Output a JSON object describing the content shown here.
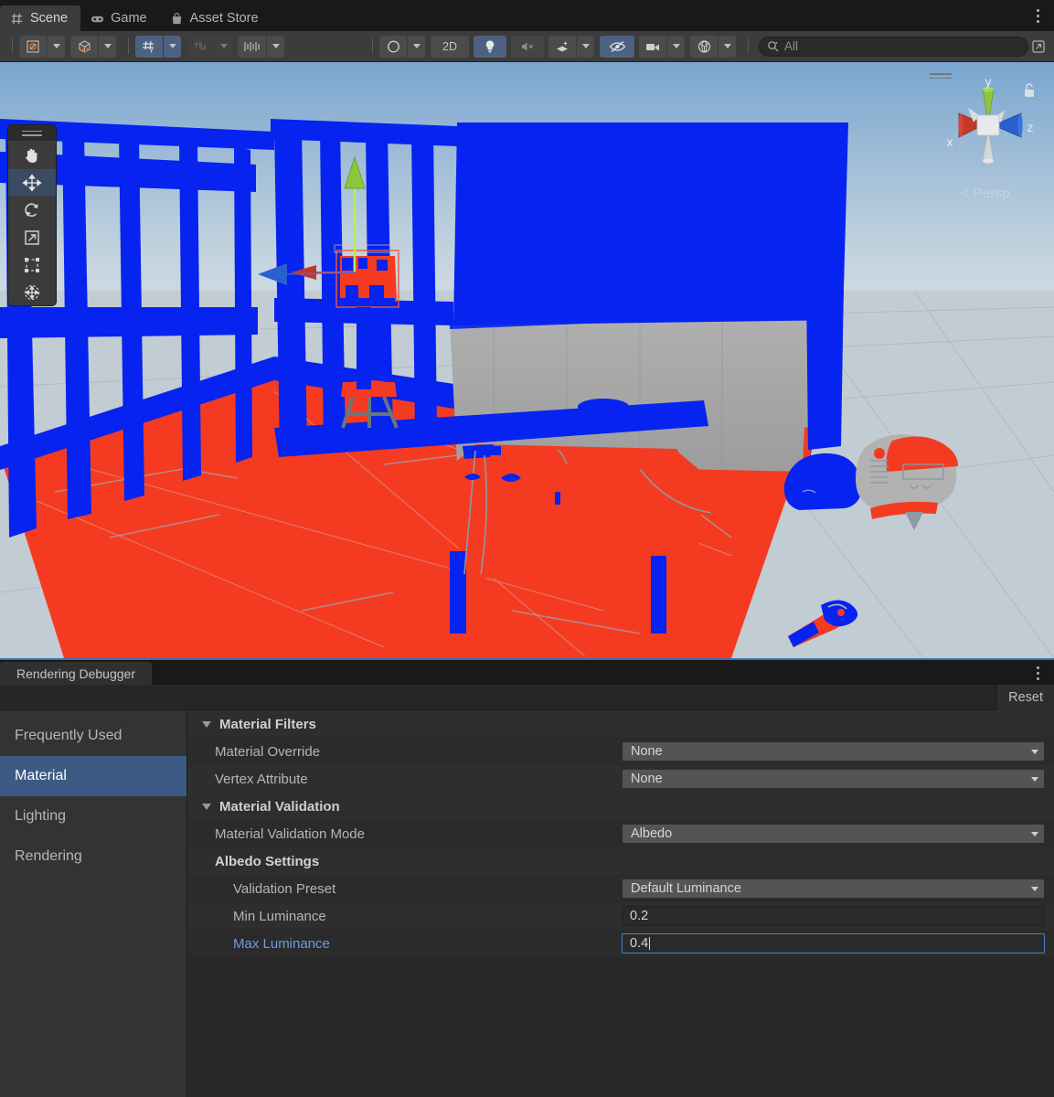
{
  "window": {
    "tabs": [
      {
        "label": "Scene",
        "icon": "grid-icon",
        "active": true
      },
      {
        "label": "Game",
        "icon": "gamepad-icon",
        "active": false
      },
      {
        "label": "Asset Store",
        "icon": "shopping-bag-icon",
        "active": false
      }
    ],
    "menu_icon": "kebab-menu-icon"
  },
  "scene_toolbar": {
    "pivot_mode": {
      "icon": "pivot-center-icon",
      "label": ""
    },
    "pivot_rotation": {
      "icon": "pivot-global-icon",
      "label": ""
    },
    "grid_snap": {
      "icon": "grid-snap-icon",
      "active": true
    },
    "magnet_snap": {
      "icon": "magnet-snap-icon",
      "active": false
    },
    "increment_snap": {
      "icon": "increment-snap-icon",
      "active": false
    },
    "shading_mode": {
      "icon": "shaded-sphere-icon"
    },
    "view_2d": {
      "label": "2D",
      "active": false
    },
    "scene_lighting": {
      "icon": "lightbulb-icon",
      "active": true
    },
    "audio": {
      "icon": "audio-mute-icon",
      "active": false
    },
    "effects": {
      "icon": "fx-sparkle-icon"
    },
    "hidden_objects": {
      "icon": "eye-slash-icon",
      "active": true
    },
    "camera": {
      "icon": "camera-icon"
    },
    "gizmos": {
      "icon": "gizmo-globe-icon"
    },
    "search": {
      "placeholder": "All",
      "value": "",
      "icon": "search-icon"
    },
    "expand": {
      "icon": "expand-panel-icon"
    }
  },
  "scene_view": {
    "tools": [
      {
        "name": "hand-tool",
        "icon": "hand-icon",
        "selected": false
      },
      {
        "name": "move-tool",
        "icon": "move-arrows-icon",
        "selected": true
      },
      {
        "name": "rotate-tool",
        "icon": "rotate-icon",
        "selected": false
      },
      {
        "name": "scale-tool",
        "icon": "scale-icon",
        "selected": false
      },
      {
        "name": "rect-tool",
        "icon": "rect-transform-icon",
        "selected": false
      },
      {
        "name": "transform-tool",
        "icon": "transform-icon",
        "selected": false
      }
    ],
    "orientation_gizmo": {
      "axis_x": "x",
      "axis_y": "y",
      "axis_z": "z",
      "projection": "< Persp",
      "lock_icon": "lock-open-icon",
      "color_x": "#c0392b",
      "color_y": "#8cc63e",
      "color_z": "#2a5fd0"
    },
    "validation_colors": {
      "too_low": "#f43b21",
      "too_high": "#0623ef",
      "valid": "#a8a8a8",
      "ground": "#c2ccd3",
      "sky_top": "#7ba6d0",
      "sky_bottom": "#dfe7ec"
    }
  },
  "debugger": {
    "tab_label": "Rendering Debugger",
    "menu_icon": "kebab-menu-icon",
    "reset_label": "Reset",
    "sidebar": [
      {
        "label": "Frequently Used",
        "selected": false
      },
      {
        "label": "Material",
        "selected": true
      },
      {
        "label": "Lighting",
        "selected": false
      },
      {
        "label": "Rendering",
        "selected": false
      }
    ],
    "sections": [
      {
        "title": "Material Filters",
        "rows": [
          {
            "label": "Material Override",
            "type": "dropdown",
            "value": "None"
          },
          {
            "label": "Vertex Attribute",
            "type": "dropdown",
            "value": "None"
          }
        ]
      },
      {
        "title": "Material Validation",
        "rows": [
          {
            "label": "Material Validation Mode",
            "type": "dropdown",
            "value": "Albedo"
          },
          {
            "label": "Albedo Settings",
            "type": "subheader"
          },
          {
            "label": "Validation Preset",
            "type": "dropdown",
            "value": "Default Luminance",
            "indent": true
          },
          {
            "label": "Min Luminance",
            "type": "text",
            "value": "0.2",
            "indent": true
          },
          {
            "label": "Max Luminance",
            "type": "text",
            "value": "0.4",
            "indent": true,
            "focused": true
          }
        ]
      }
    ]
  }
}
